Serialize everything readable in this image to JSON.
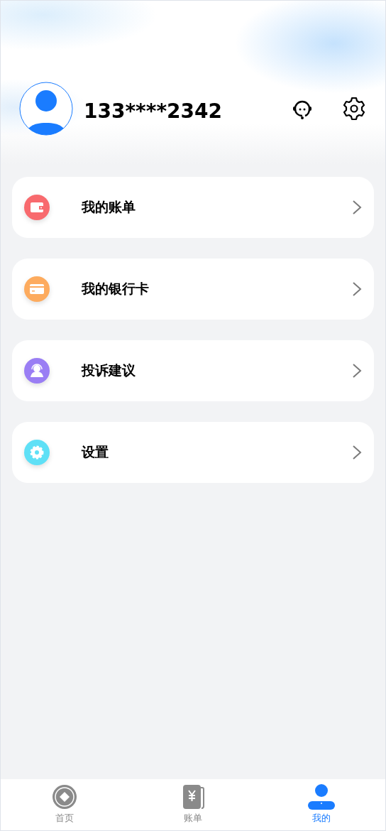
{
  "profile": {
    "phone": "133****2342"
  },
  "menu": [
    {
      "kind": "wallet",
      "label": "我的账单",
      "color": "#f86a6e"
    },
    {
      "kind": "card",
      "label": "我的银行卡",
      "color": "#fdab5e"
    },
    {
      "kind": "agent",
      "label": "投诉建议",
      "color": "#9a7ef4"
    },
    {
      "kind": "gear",
      "label": "设置",
      "color": "#5fe0f6"
    }
  ],
  "tabs": [
    {
      "kind": "home",
      "label": "首页",
      "selected": false
    },
    {
      "kind": "bill",
      "label": "账单",
      "selected": false
    },
    {
      "kind": "me",
      "label": "我的",
      "selected": true
    }
  ]
}
